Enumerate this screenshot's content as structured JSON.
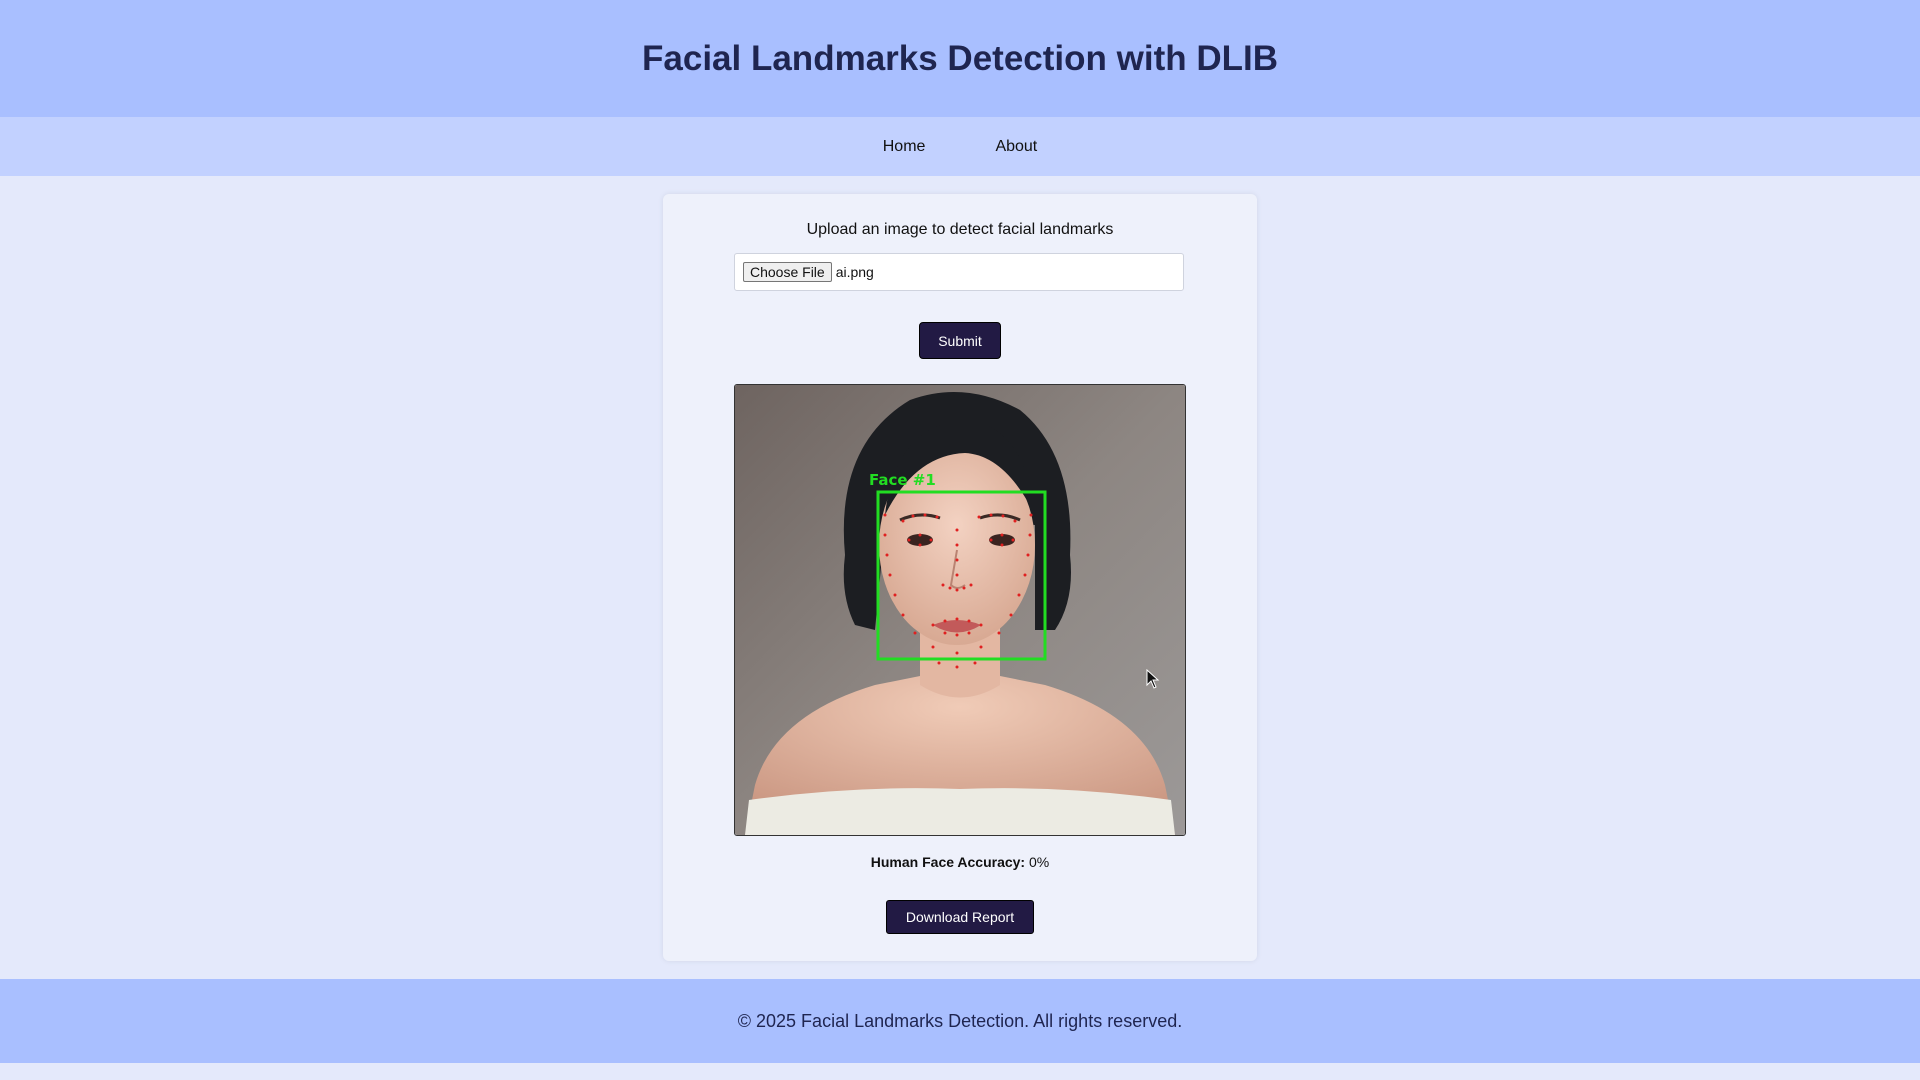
{
  "header": {
    "title": "Facial Landmarks Detection with DLIB"
  },
  "nav": {
    "items": [
      {
        "label": "Home"
      },
      {
        "label": "About"
      }
    ]
  },
  "upload": {
    "prompt": "Upload an image to detect facial landmarks",
    "choose_label": "Choose File",
    "file_name": "ai.png",
    "submit_label": "Submit"
  },
  "result": {
    "face_box_label": "Face #1",
    "accuracy_label": "Human Face Accuracy:",
    "accuracy_value": "0%",
    "download_label": "Download Report"
  },
  "footer": {
    "text": "© 2025 Facial Landmarks Detection. All rights reserved."
  },
  "colors": {
    "header_bg": "#a9bfff",
    "nav_bg": "#c2d1ff",
    "page_bg": "#e4e9fb",
    "button_bg": "#221a44",
    "box_green": "#22dd22",
    "landmark_red": "#e02020"
  }
}
